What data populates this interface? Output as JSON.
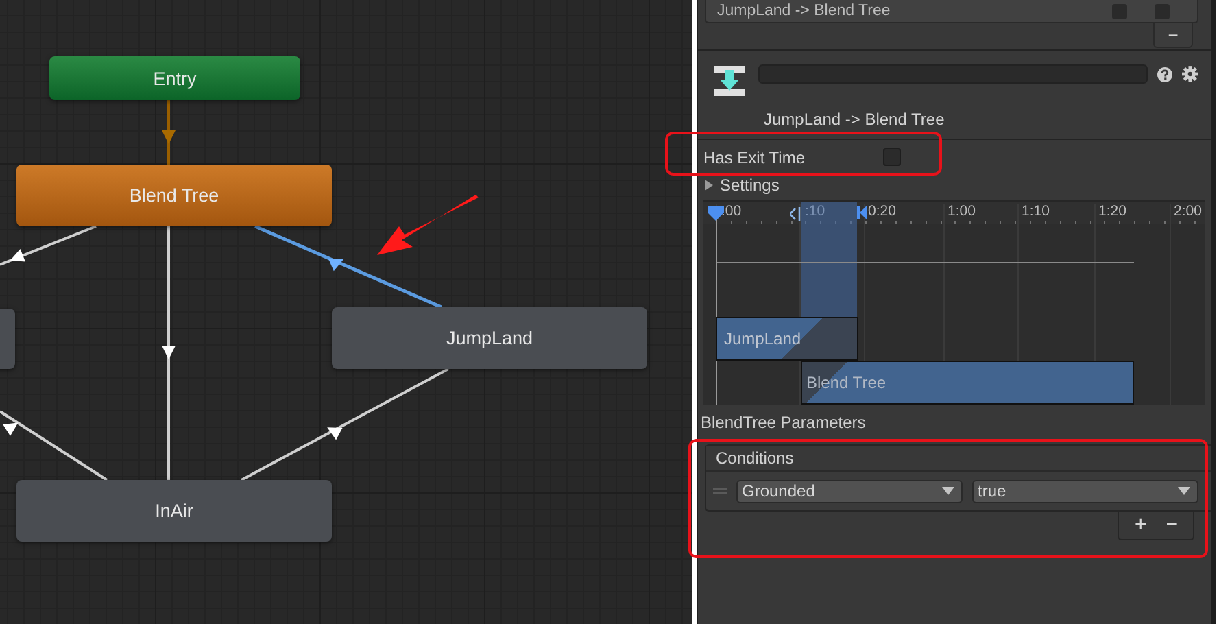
{
  "graph": {
    "nodes": [
      {
        "label": "Entry",
        "kind": "entry"
      },
      {
        "label": "Blend Tree",
        "kind": "default"
      },
      {
        "label": "JumpLand",
        "kind": "state"
      },
      {
        "label": "InAir",
        "kind": "state"
      }
    ],
    "transitions": [
      {
        "selected": false,
        "kind": "entry"
      },
      {
        "selected": false,
        "kind": "normal"
      },
      {
        "selected": false,
        "kind": "normal"
      },
      {
        "selected": true,
        "kind": "normal"
      },
      {
        "selected": false,
        "kind": "normal"
      },
      {
        "selected": false,
        "kind": "normal"
      }
    ]
  },
  "inspector": {
    "transition_list": {
      "rows": [
        {
          "label": "JumpLand -> Blend Tree",
          "toggles": [
            {
              "checked": false
            },
            {
              "checked": false
            }
          ]
        }
      ],
      "remove_button": "−"
    },
    "header": {
      "title": "JumpLand -> Blend Tree"
    },
    "has_exit_time": {
      "label": "Has Exit Time",
      "checked": false
    },
    "settings": {
      "label": "Settings",
      "expanded": false
    },
    "timeline": {
      "ticks": [
        ":00",
        ":10",
        "0:20",
        "1:00",
        "1:10",
        "1:20",
        "2:00"
      ],
      "clips": [
        {
          "label": "JumpLand",
          "kind": "source"
        },
        {
          "label": "Blend Tree",
          "kind": "target"
        }
      ]
    },
    "parameters_label": "BlendTree Parameters",
    "conditions": {
      "title": "Conditions",
      "rows": [
        {
          "parameter": "Grounded",
          "value": "true"
        }
      ],
      "buttons": [
        "+",
        "−"
      ]
    }
  }
}
